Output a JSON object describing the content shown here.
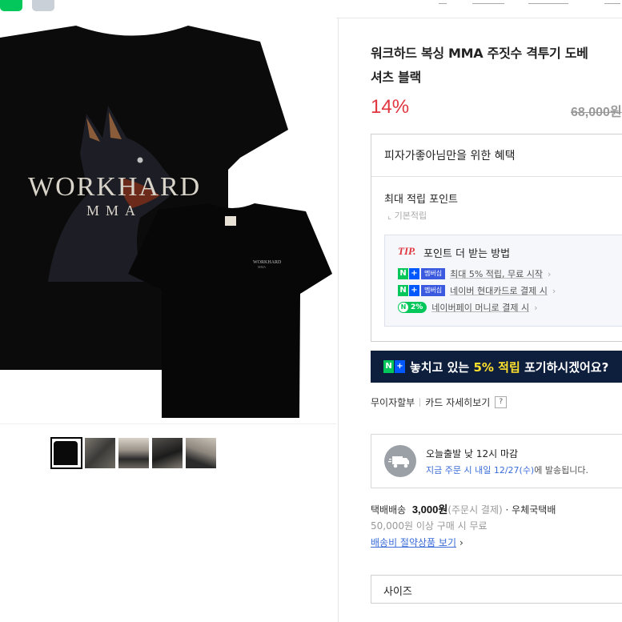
{
  "product": {
    "title_line1": "워크하드 복싱 MMA 주짓수 격투기 도베",
    "title_line2": "셔츠 블랙",
    "discount": "14%",
    "original_price": "68,000원",
    "print_brand": "WORKHARD",
    "print_sub": "MMA"
  },
  "benefit": {
    "title": "피자가좋아님만을 위한 혜택",
    "max_point": "최대 적립 포인트",
    "basic_point": "기본적립",
    "tip_label": "TIP.",
    "tip_text": "포인트 더 받는 방법",
    "tip_plus": "+",
    "rows": [
      {
        "badge": "멤버십",
        "text": "최대 5% 적립, 무료 시작"
      },
      {
        "badge": "멤버십",
        "text": "네이버 현대카드로 결제 시"
      },
      {
        "badge": "2%",
        "text": "네이버페이 머니로 결제 시"
      }
    ]
  },
  "banner": {
    "text_pre": "놓치고 있는",
    "text_hl": "5% 적립",
    "text_post": "포기하시겠어요?"
  },
  "installment": {
    "label1": "무이자할부",
    "label2": "카드 자세히보기",
    "q": "?"
  },
  "shipping": {
    "line1": "오늘출발 낮 12시 마감",
    "line2_blue": "지금 주문 시 내일 12/27(수)",
    "line2_rest": "에 발송됩니다."
  },
  "delivery": {
    "type": "택배배송",
    "fee": "3,000원",
    "note": "(주문시 결제)",
    "carrier": "· 우체국택배",
    "free_cond": "50,000원 이상 구매 시 무료",
    "save_link": "배송비 절약상품 보기",
    "chev": "›"
  },
  "option": {
    "size_label": "사이즈"
  },
  "icons": {
    "chevron": "›"
  },
  "colors": {
    "discount": "#e0343e",
    "banner_bg": "#0e1f3e",
    "banner_hl": "#ffe12b",
    "naver_green": "#03c75a",
    "link_blue": "#3a6cd8"
  }
}
